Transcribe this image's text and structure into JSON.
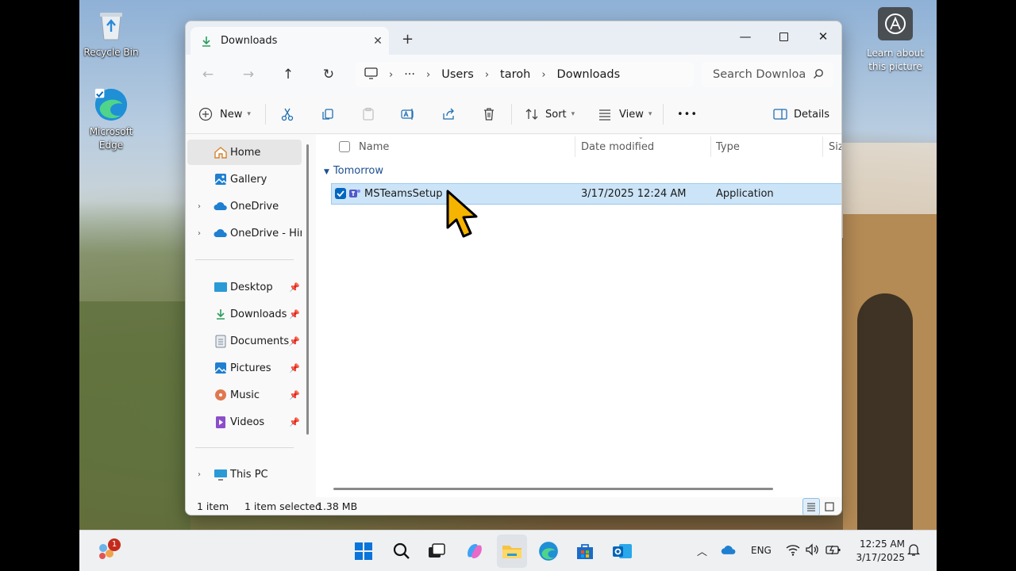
{
  "desktop": {
    "icons": [
      {
        "label": "Recycle Bin",
        "icon": "recycle-bin-icon"
      },
      {
        "label": "Microsoft Edge",
        "icon": "edge-icon"
      }
    ],
    "learn_label": "Learn about this picture"
  },
  "window": {
    "tab_title": "Downloads",
    "address": {
      "more": "···",
      "crumbs": [
        "Users",
        "taroh",
        "Downloads"
      ]
    },
    "search_placeholder": "Search Downloa",
    "toolbar": {
      "new": "New",
      "sort": "Sort",
      "view": "View",
      "more": "•••",
      "details": "Details"
    },
    "nav": {
      "home": "Home",
      "gallery": "Gallery",
      "onedrive": "OneDrive",
      "onedrive_hiro": "OneDrive - Hiros",
      "desktop": "Desktop",
      "downloads": "Downloads",
      "documents": "Documents",
      "pictures": "Pictures",
      "music": "Music",
      "videos": "Videos",
      "this_pc": "This PC"
    },
    "columns": {
      "name": "Name",
      "date": "Date modified",
      "type": "Type",
      "size": "Size"
    },
    "group": "Tomorrow",
    "files": [
      {
        "name": "MSTeamsSetup",
        "date": "3/17/2025 12:24 AM",
        "type": "Application"
      }
    ],
    "status": {
      "count": "1 item",
      "selected": "1 item selected",
      "size": "1.38 MB"
    }
  },
  "taskbar": {
    "notification_count": "1",
    "lang": "ENG",
    "time": "12:25 AM",
    "date": "3/17/2025"
  },
  "colors": {
    "selection": "#cce4f7",
    "accent": "#0067c0",
    "group": "#1d4f91"
  }
}
